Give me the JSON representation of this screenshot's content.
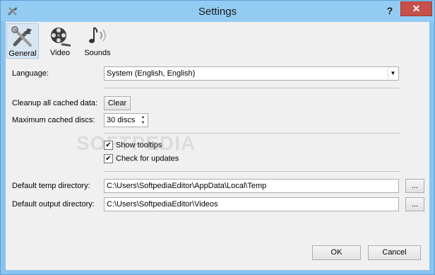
{
  "window": {
    "title": "Settings",
    "help_label": "?",
    "close_label": "✕"
  },
  "toolbar": [
    {
      "label": "General",
      "icon": "tools-icon",
      "active": true
    },
    {
      "label": "Video",
      "icon": "film-reel-icon",
      "active": false
    },
    {
      "label": "Sounds",
      "icon": "music-note-icon",
      "active": false
    }
  ],
  "language": {
    "label": "Language:",
    "value": "System (English, English)"
  },
  "cache": {
    "label": "Cleanup all cached data:",
    "button": "Clear"
  },
  "max_discs": {
    "label": "Maximum cached discs:",
    "value": "30 discs"
  },
  "options": {
    "show_tooltips": {
      "label": "Show tooltips",
      "checked": true
    },
    "check_updates": {
      "label": "Check for updates",
      "checked": true
    }
  },
  "temp_dir": {
    "label": "Default temp directory:",
    "value": "C:\\Users\\SoftpediaEditor\\AppData\\Local\\Temp",
    "browse": "..."
  },
  "output_dir": {
    "label": "Default output directory:",
    "value": "C:\\Users\\SoftpediaEditor\\Videos",
    "browse": "..."
  },
  "footer": {
    "ok": "OK",
    "cancel": "Cancel"
  },
  "watermark": "SOFTPEDIA"
}
